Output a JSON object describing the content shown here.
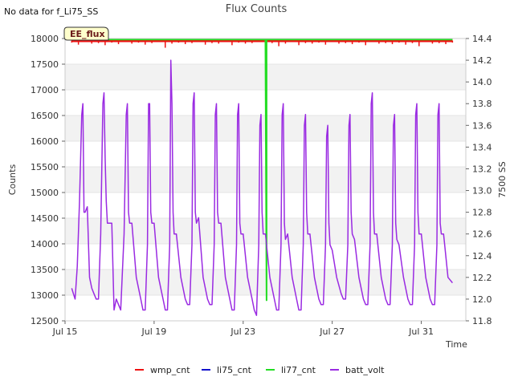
{
  "header": {
    "status_note": "No data for f_Li75_SS",
    "title": "Flux Counts"
  },
  "badge": {
    "label": "EE_flux"
  },
  "chart_data": {
    "type": "line",
    "title": "Flux Counts",
    "xlabel": "Time",
    "ylabel": "Counts",
    "y2label": "7500 SS",
    "xlim": [
      15.0,
      33.0
    ],
    "ylim": [
      12500,
      18000
    ],
    "y2lim": [
      11.8,
      14.4
    ],
    "x_ticks": [
      15,
      19,
      23,
      27,
      31
    ],
    "x_tick_labels": [
      "Jul 15",
      "Jul 19",
      "Jul 23",
      "Jul 27",
      "Jul 31"
    ],
    "y_ticks": [
      12500,
      13000,
      13500,
      14000,
      14500,
      15000,
      15500,
      16000,
      16500,
      17000,
      17500,
      18000
    ],
    "y2_ticks": [
      11.8,
      12.0,
      12.2,
      12.4,
      12.6,
      12.8,
      13.0,
      13.2,
      13.4,
      13.6,
      13.8,
      14.0,
      14.2,
      14.4
    ],
    "grid": "horizontal bands",
    "legend_position": "bottom",
    "series": [
      {
        "name": "wmp_cnt",
        "color": "#ee1111",
        "axis": "left",
        "x": [
          15.3,
          15.6,
          15.9,
          16.2,
          16.5,
          16.8,
          17.1,
          17.4,
          17.7,
          18.0,
          18.3,
          18.6,
          18.9,
          19.2,
          19.5,
          19.8,
          20.1,
          20.4,
          20.7,
          21.0,
          21.3,
          21.6,
          21.9,
          22.2,
          22.5,
          22.8,
          23.1,
          23.4,
          23.7,
          24.0,
          24.3,
          24.6,
          24.9,
          25.2,
          25.5,
          25.8,
          26.1,
          26.4,
          26.7,
          27.0,
          27.3,
          27.6,
          27.9,
          28.2,
          28.5,
          28.8,
          29.1,
          29.4,
          29.7,
          30.0,
          30.3,
          30.6,
          30.9,
          31.2,
          31.5,
          31.8,
          32.1,
          32.4
        ],
        "y": [
          17920,
          17880,
          17930,
          17900,
          17910,
          17870,
          17920,
          17890,
          17930,
          17900,
          17920,
          17880,
          17910,
          17930,
          17820,
          17900,
          17920,
          17890,
          17910,
          17930,
          17880,
          17910,
          17900,
          17930,
          17870,
          17920,
          17900,
          17910,
          17930,
          17890,
          17910,
          17850,
          17900,
          17930,
          17870,
          17910,
          17900,
          17920,
          17880,
          17930,
          17900,
          17910,
          17890,
          17920,
          17870,
          17930,
          17900,
          17910,
          17890,
          17920,
          17880,
          17910,
          17850,
          17930,
          17900,
          17910,
          17890,
          17920
        ]
      },
      {
        "name": "li75_cnt",
        "color": "#1111cc",
        "axis": "left",
        "x": [],
        "y": []
      },
      {
        "name": "li77_cnt",
        "color": "#22dd22",
        "axis": "left",
        "x": [
          15.3,
          24.0,
          24.0,
          24.05,
          24.05,
          32.4
        ],
        "y": [
          17980,
          17980,
          17990,
          12900,
          17980,
          17980
        ]
      },
      {
        "name": "batt_volt",
        "color": "#9a2be2",
        "axis": "right",
        "x": [
          15.3,
          15.45,
          15.55,
          15.65,
          15.75,
          15.8,
          15.85,
          15.9,
          16.0,
          16.1,
          16.2,
          16.3,
          16.4,
          16.5,
          16.6,
          16.7,
          16.75,
          16.8,
          16.85,
          16.9,
          17.0,
          17.1,
          17.2,
          17.3,
          17.5,
          17.65,
          17.75,
          17.8,
          17.85,
          17.9,
          18.0,
          18.2,
          18.4,
          18.5,
          18.6,
          18.7,
          18.75,
          18.8,
          18.85,
          18.9,
          19.0,
          19.2,
          19.4,
          19.5,
          19.6,
          19.7,
          19.75,
          19.8,
          19.85,
          19.9,
          20.0,
          20.2,
          20.4,
          20.5,
          20.6,
          20.7,
          20.75,
          20.8,
          20.85,
          20.9,
          21.0,
          21.2,
          21.4,
          21.5,
          21.6,
          21.7,
          21.75,
          21.8,
          21.85,
          21.9,
          22.0,
          22.2,
          22.4,
          22.5,
          22.6,
          22.7,
          22.75,
          22.8,
          22.85,
          22.9,
          23.0,
          23.2,
          23.4,
          23.5,
          23.6,
          23.7,
          23.75,
          23.8,
          23.85,
          23.9,
          24.0,
          24.2,
          24.4,
          24.5,
          24.6,
          24.7,
          24.75,
          24.8,
          24.85,
          24.9,
          25.0,
          25.2,
          25.4,
          25.5,
          25.6,
          25.7,
          25.75,
          25.8,
          25.85,
          25.9,
          26.0,
          26.2,
          26.4,
          26.5,
          26.6,
          26.7,
          26.75,
          26.8,
          26.85,
          26.9,
          27.0,
          27.2,
          27.4,
          27.5,
          27.6,
          27.7,
          27.75,
          27.8,
          27.85,
          27.9,
          28.0,
          28.2,
          28.4,
          28.5,
          28.6,
          28.7,
          28.75,
          28.8,
          28.85,
          28.9,
          29.0,
          29.2,
          29.4,
          29.5,
          29.6,
          29.7,
          29.75,
          29.8,
          29.85,
          29.9,
          30.0,
          30.2,
          30.4,
          30.5,
          30.6,
          30.7,
          30.75,
          30.8,
          30.85,
          30.9,
          31.0,
          31.2,
          31.4,
          31.5,
          31.6,
          31.7,
          31.75,
          31.8,
          31.85,
          31.9,
          32.0,
          32.2,
          32.4
        ],
        "y": [
          12.1,
          12.0,
          12.3,
          12.9,
          13.7,
          13.8,
          12.8,
          12.8,
          12.85,
          12.2,
          12.1,
          12.05,
          12.0,
          12.0,
          12.6,
          13.8,
          13.9,
          13.3,
          12.9,
          12.7,
          12.7,
          12.7,
          11.9,
          12.0,
          11.9,
          12.6,
          13.7,
          13.8,
          12.8,
          12.7,
          12.7,
          12.2,
          12.0,
          11.9,
          11.9,
          12.5,
          13.8,
          13.8,
          12.8,
          12.7,
          12.7,
          12.2,
          12.0,
          11.9,
          11.9,
          12.5,
          14.2,
          13.8,
          12.8,
          12.6,
          12.6,
          12.2,
          12.0,
          11.95,
          11.95,
          12.5,
          13.8,
          13.9,
          12.8,
          12.7,
          12.75,
          12.2,
          12.0,
          11.95,
          11.95,
          12.5,
          13.7,
          13.8,
          12.8,
          12.7,
          12.7,
          12.2,
          12.0,
          11.9,
          11.9,
          12.5,
          13.7,
          13.8,
          12.7,
          12.6,
          12.6,
          12.2,
          12.0,
          11.9,
          11.85,
          12.5,
          13.6,
          13.7,
          12.8,
          12.6,
          12.6,
          12.2,
          12.0,
          11.9,
          11.9,
          12.5,
          13.7,
          13.8,
          12.7,
          12.55,
          12.6,
          12.2,
          12.0,
          11.9,
          11.9,
          12.5,
          13.6,
          13.7,
          12.8,
          12.6,
          12.6,
          12.2,
          12.0,
          11.95,
          11.95,
          12.5,
          13.5,
          13.6,
          12.7,
          12.5,
          12.45,
          12.2,
          12.05,
          12.0,
          12.0,
          12.5,
          13.6,
          13.7,
          12.8,
          12.6,
          12.55,
          12.2,
          12.0,
          11.95,
          11.95,
          12.5,
          13.8,
          13.9,
          12.8,
          12.6,
          12.6,
          12.2,
          12.0,
          11.95,
          11.95,
          12.5,
          13.6,
          13.7,
          12.7,
          12.55,
          12.5,
          12.2,
          12.0,
          11.95,
          11.95,
          12.5,
          13.7,
          13.8,
          12.8,
          12.6,
          12.6,
          12.2,
          12.0,
          11.95,
          11.95,
          12.5,
          13.7,
          13.8,
          12.7,
          12.6,
          12.6,
          12.2,
          12.15
        ]
      }
    ]
  }
}
